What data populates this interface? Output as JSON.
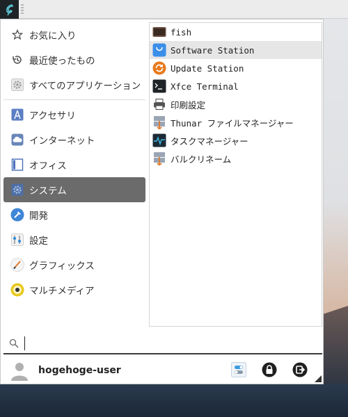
{
  "favorites_section": [
    {
      "label": "お気に入り",
      "icon": "star-icon"
    },
    {
      "label": "最近使ったもの",
      "icon": "history-icon"
    },
    {
      "label": "すべてのアプリケーション",
      "icon": "gear-icon"
    }
  ],
  "categories": [
    {
      "label": "アクセサリ",
      "icon": "accessories-icon"
    },
    {
      "label": "インターネット",
      "icon": "cloud-icon"
    },
    {
      "label": "オフィス",
      "icon": "document-icon"
    },
    {
      "label": "システム",
      "icon": "gear-icon",
      "selected": true
    },
    {
      "label": "開発",
      "icon": "hammer-icon"
    },
    {
      "label": "設定",
      "icon": "settings-icon"
    },
    {
      "label": "グラフィックス",
      "icon": "brush-icon"
    },
    {
      "label": "マルチメディア",
      "icon": "speaker-icon"
    }
  ],
  "apps": [
    {
      "label": "fish",
      "icon": "terminal-fish-icon"
    },
    {
      "label": "Software Station",
      "icon": "software-bag-icon",
      "highlighted": true
    },
    {
      "label": "Update Station",
      "icon": "update-icon"
    },
    {
      "label": "Xfce Terminal",
      "icon": "terminal-icon"
    },
    {
      "label": "印刷設定",
      "icon": "printer-icon"
    },
    {
      "label": "Thunar ファイルマネージャー",
      "icon": "file-manager-icon"
    },
    {
      "label": "タスクマネージャー",
      "icon": "task-manager-icon"
    },
    {
      "label": "バルクリネーム",
      "icon": "bulk-rename-icon"
    }
  ],
  "search": {
    "value": "",
    "placeholder": ""
  },
  "user": {
    "name": "hogehoge-user"
  },
  "colors": {
    "selected_bg": "#6b6b6b",
    "hover_bg": "#e6e6e6",
    "panel_button_bg": "#1e2327"
  }
}
